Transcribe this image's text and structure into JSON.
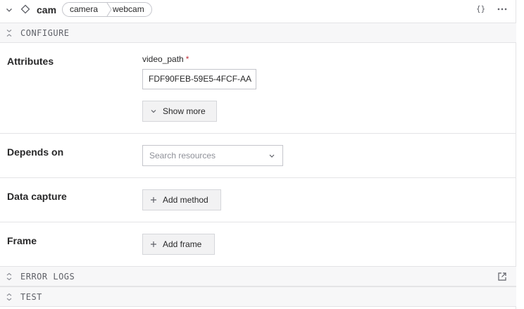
{
  "header": {
    "resource_name": "cam",
    "breadcrumbs": [
      "camera",
      "webcam"
    ],
    "json_label": "{}",
    "icons": {
      "collapse": "chevron-down-icon",
      "resource": "diamond-icon",
      "more": "more-horizontal-icon"
    }
  },
  "sections": {
    "configure": "CONFIGURE",
    "error_logs": "ERROR LOGS",
    "test": "TEST"
  },
  "attributes": {
    "title": "Attributes",
    "field_label": "video_path",
    "required_mark": "*",
    "field_value": "FDF90FEB-59E5-4FCF-AA",
    "show_more_label": "Show more"
  },
  "depends_on": {
    "title": "Depends on",
    "placeholder": "Search resources"
  },
  "data_capture": {
    "title": "Data capture",
    "button_label": "Add method"
  },
  "frame": {
    "title": "Frame",
    "button_label": "Add frame"
  },
  "colors": {
    "text": "#282829",
    "muted": "#5f6168",
    "border": "#e4e4e6",
    "bar_bg": "#f7f7f8",
    "required": "#c0333d"
  }
}
